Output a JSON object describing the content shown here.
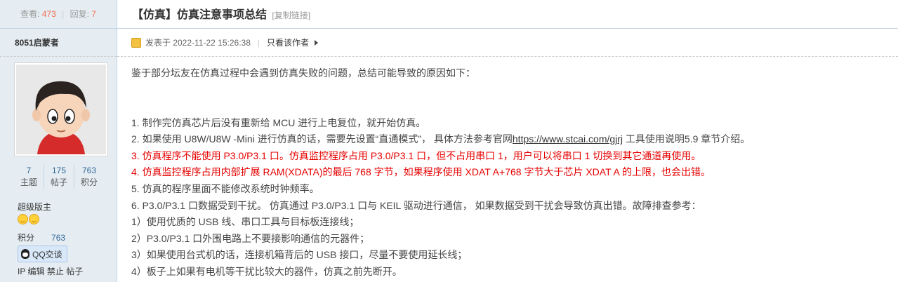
{
  "stats": {
    "views_label": "查看:",
    "views": "473",
    "replies_label": "回复:",
    "replies": "7"
  },
  "author": {
    "name": "8051启蒙者"
  },
  "user_stats": [
    {
      "value": "7",
      "label": "主题"
    },
    {
      "value": "175",
      "label": "帖子"
    },
    {
      "value": "763",
      "label": "积分"
    }
  ],
  "user": {
    "group": "超级版主",
    "points_label": "积分",
    "points": "763",
    "qq_label": "QQ交谈",
    "admin_links": [
      "IP",
      "编辑",
      "禁止",
      "帖子"
    ]
  },
  "post": {
    "title": "【仿真】仿真注意事项总结",
    "copy_link": "[复制链接]",
    "posted_label": "发表于 2022-11-22 15:26:38",
    "only_author": "只看该作者",
    "intro": "鉴于部分坛友在仿真过程中会遇到仿真失败的问题，总结可能导致的原因如下：",
    "item1": "1.  制作完仿真芯片后没有重新给 MCU 进行上电复位，就开始仿真。",
    "item2_before": "2.  如果使用 U8W/U8W -Mini 进行仿真的话，需要先设置“直通模式”， 具体方法参考官网",
    "item2_link": "https://www.stcai.com/gjrj",
    "item2_after": " 工具使用说明5.9 章节介绍。",
    "item3": "3.  仿真程序不能使用 P3.0/P3.1 口。仿真监控程序占用 P3.0/P3.1 口，但不占用串口 1，用户可以将串口 1 切换到其它通道再使用。",
    "item4": "4.  仿真监控程序占用内部扩展 RAM(XDATA)的最后 768 字节，如果程序使用 XDAT A+768 字节大于芯片 XDAT A 的上限，也会出错。",
    "item5": "5.  仿真的程序里面不能修改系统时钟频率。",
    "item6": "6.  P3.0/P3.1 口数据受到干扰。 仿真通过 P3.0/P3.1 口与 KEIL 驱动进行通信， 如果数据受到干扰会导致仿真出错。故障排查参考：",
    "sub1": "1）使用优质的 USB 线、串口工具与目标板连接线；",
    "sub2": "2）P3.0/P3.1 口外围电路上不要接影响通信的元器件；",
    "sub3": "3）如果使用台式机的话，连接机箱背后的 USB 接口，尽量不要使用延长线；",
    "sub4": "4）板子上如果有电机等干扰比较大的器件，仿真之前先断开。"
  },
  "colors": {
    "red_text": "#e60000",
    "sidebar_bg": "#e5edf2",
    "border": "#c2d5e3"
  },
  "icons": [
    "avatar-image",
    "smiley-icon",
    "qq-penguin-icon",
    "post-icon",
    "arrow-right-icon"
  ]
}
